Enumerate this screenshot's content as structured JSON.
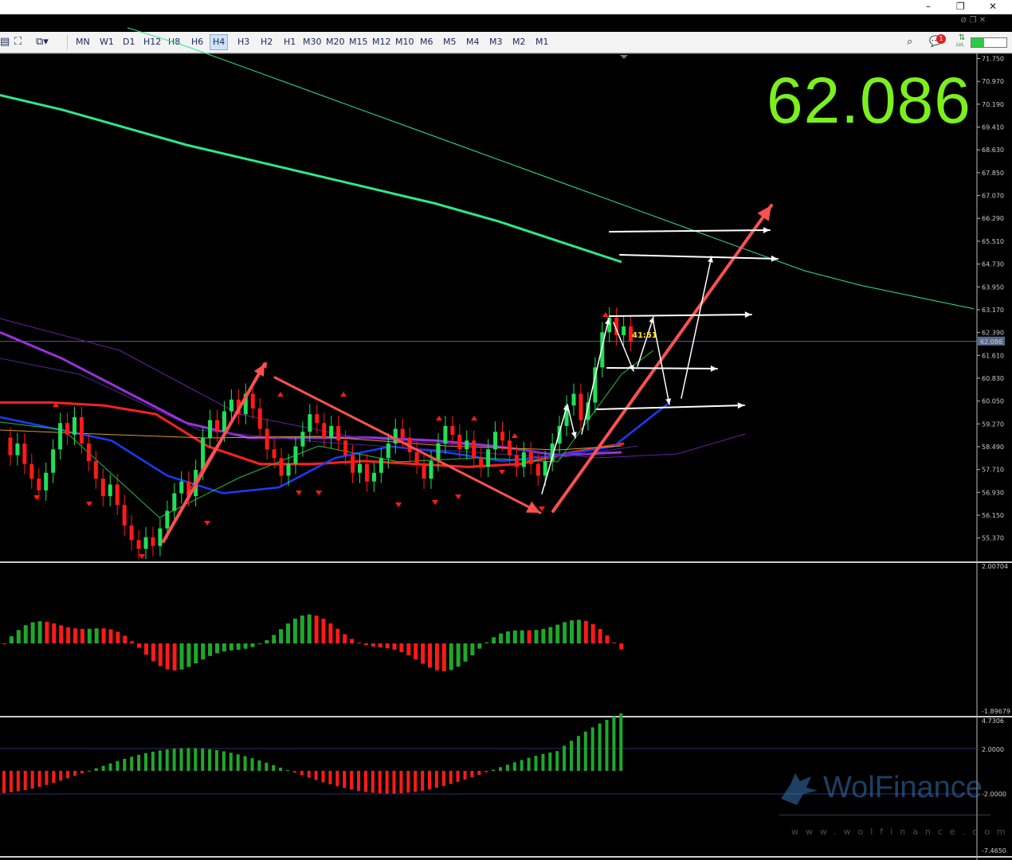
{
  "toolbar": {
    "timeframes": [
      "MN",
      "W1",
      "D1",
      "H12",
      "H8",
      "H6",
      "H4",
      "H3",
      "H2",
      "H1",
      "M30",
      "M20",
      "M15",
      "M12",
      "M10",
      "M6",
      "M5",
      "M4",
      "M3",
      "M2",
      "M1"
    ],
    "active_timeframe": "H4",
    "notification_count": "1",
    "level_label": "LVL"
  },
  "window": {
    "minimize": "–",
    "restore": "❐",
    "close": "✕"
  },
  "price_display": "62.086",
  "bar_timer": "41:51",
  "watermark": {
    "name": "WolFinance",
    "site": "www.wolfinance.com"
  },
  "colors": {
    "bull": "#1fe05a",
    "bear": "#ff1a1a",
    "ma_green": "#2de88a",
    "ma_blue": "#1a3cff",
    "ma_red": "#ff2020",
    "ma_purple": "#9b30e0",
    "arrow_red": "#ff5050",
    "price_green": "#7cf01e"
  },
  "chart_data": [
    {
      "type": "candlestick",
      "panel": "main",
      "y_ticks": [
        71.75,
        70.97,
        70.19,
        69.41,
        68.63,
        67.85,
        67.07,
        66.29,
        65.51,
        64.73,
        63.95,
        63.17,
        62.39,
        61.61,
        60.83,
        60.05,
        59.27,
        58.49,
        57.71,
        56.93,
        56.15,
        55.37
      ],
      "ylim": [
        54.6,
        71.9
      ],
      "current_price": 62.086,
      "series": [
        {
          "name": "price",
          "values": [
            58.8,
            58.2,
            58.6,
            57.9,
            57.4,
            57.0,
            57.6,
            58.4,
            59.3,
            58.9,
            59.5,
            58.6,
            58.0,
            57.4,
            56.8,
            57.2,
            56.5,
            55.8,
            55.3,
            55.0,
            55.4,
            55.1,
            55.7,
            56.3,
            56.9,
            57.3,
            56.8,
            57.7,
            58.8,
            59.4,
            59.0,
            59.7,
            60.1,
            59.6,
            60.3,
            59.8,
            59.1,
            58.4,
            58.1,
            57.5,
            57.9,
            58.5,
            59.0,
            59.6,
            59.3,
            58.8,
            59.2,
            58.7,
            58.2,
            57.6,
            57.9,
            57.3,
            57.6,
            58.1,
            58.6,
            59.1,
            58.8,
            58.3,
            57.9,
            57.4,
            58.0,
            58.6,
            59.2,
            58.9,
            58.4,
            58.7,
            58.1,
            57.8,
            58.4,
            59.0,
            58.7,
            58.2,
            57.8,
            58.3,
            57.9,
            57.5,
            58.0,
            58.6,
            59.2,
            59.9,
            60.3,
            59.4,
            60.0,
            61.2,
            62.4,
            62.9,
            62.3,
            62.6,
            62.1
          ]
        },
        {
          "name": "ma200",
          "values": [
            72.8,
            72.2,
            71.5,
            70.8,
            70.1,
            69.4,
            68.7,
            68.0,
            67.3,
            66.6,
            65.9,
            65.2,
            64.5,
            64.0,
            63.6,
            63.2
          ]
        },
        {
          "name": "ma100",
          "values": [
            70.5,
            70.0,
            69.4,
            68.8,
            68.3,
            67.8,
            67.3,
            66.8,
            66.2,
            65.5,
            64.8
          ]
        },
        {
          "name": "ma_red",
          "values": [
            60.0,
            60.0,
            59.9,
            59.6,
            58.5,
            57.9,
            57.9,
            58.0,
            57.9,
            57.8,
            57.9,
            58.3,
            58.6
          ]
        },
        {
          "name": "ma_purple",
          "values": [
            62.4,
            61.5,
            60.4,
            59.3,
            58.8,
            58.8,
            58.8,
            58.7,
            58.5,
            58.2,
            58.3
          ]
        },
        {
          "name": "ma_blue",
          "values": [
            59.5,
            59.1,
            58.7,
            57.5,
            56.9,
            57.1,
            58.1,
            58.5,
            58.3,
            58.0,
            58.2,
            58.5,
            60.0
          ]
        }
      ]
    },
    {
      "type": "histogram",
      "panel": "oscillator1",
      "y_ticks": [
        2.00704,
        -1.89679
      ],
      "ylim": [
        -1.89679,
        2.00704
      ]
    },
    {
      "type": "histogram",
      "panel": "oscillator2",
      "y_ticks": [
        4.7306,
        2.0,
        -2.0,
        -7.465
      ],
      "ylim": [
        -7.465,
        4.7306
      ]
    }
  ]
}
